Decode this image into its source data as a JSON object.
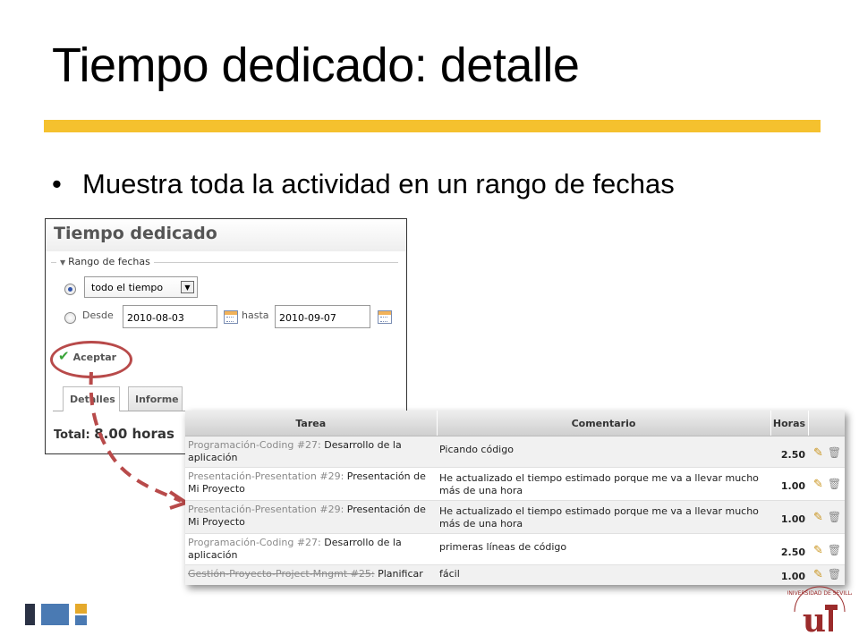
{
  "slide": {
    "title": "Tiempo dedicado: detalle",
    "bullet": "Muestra toda la actividad en un rango de fechas"
  },
  "panel": {
    "title": "Tiempo dedicado",
    "legend": "Rango de fechas",
    "select_value": "todo el tiempo",
    "desde_label": "Desde",
    "desde_value": "2010-08-03",
    "hasta_label": "hasta",
    "hasta_value": "2010-09-07",
    "accept_label": "Aceptar",
    "tabs": [
      "Detalles",
      "Informe"
    ],
    "total_label": "Total:",
    "total_value": "8.00 horas"
  },
  "table": {
    "headers": [
      "Tarea",
      "Comentario",
      "Horas"
    ],
    "rows": [
      {
        "project": "Programación-Coding #27:",
        "task": "Desarrollo de la aplicación",
        "comment": "Picando código",
        "hours": "2.50",
        "strike": false
      },
      {
        "project": "Presentación-Presentation #29:",
        "task": "Presentación de Mi Proyecto",
        "comment": "He actualizado el tiempo estimado porque me va a llevar mucho más de una hora",
        "hours": "1.00",
        "strike": false
      },
      {
        "project": "Presentación-Presentation #29:",
        "task": "Presentación de Mi Proyecto",
        "comment": "He actualizado el tiempo estimado porque me va a llevar mucho más de una hora",
        "hours": "1.00",
        "strike": false
      },
      {
        "project": "Programación-Coding #27:",
        "task": "Desarrollo de la aplicación",
        "comment": "primeras líneas de código",
        "hours": "2.50",
        "strike": false
      },
      {
        "project": "Gestión-Proyecto-Project-Mngmt #25:",
        "task": "Planificar",
        "comment": "fácil",
        "hours": "1.00",
        "strike": true
      }
    ]
  },
  "colors": {
    "accent_rule": "#f5c12e",
    "highlight": "#b84a4a",
    "logo_dark": "#2b3245",
    "logo_blue": "#4a7ab3",
    "logo_yellow": "#e5a92b",
    "seal_red": "#9b2b2b"
  },
  "icons": [
    "radio-checked",
    "radio-unchecked",
    "calendar-icon",
    "check-icon",
    "pencil-icon",
    "trash-icon",
    "dropdown-arrow-icon"
  ]
}
